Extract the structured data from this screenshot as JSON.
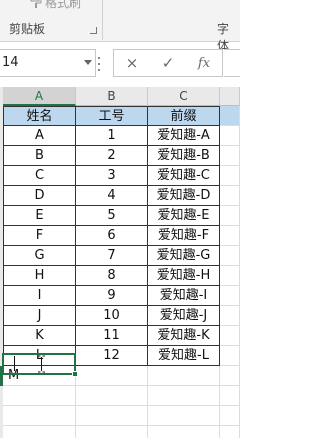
{
  "ribbon": {
    "format_painter_label": "格式刷",
    "clipboard_group_label": "剪贴板",
    "font_group_label": "字体"
  },
  "formula_bar": {
    "name_box_value": "14",
    "cancel_symbol": "×",
    "enter_symbol": "✓",
    "fx_label": "fx"
  },
  "columns": [
    "A",
    "B",
    "C"
  ],
  "table": {
    "headers": [
      "姓名",
      "工号",
      "前缀"
    ],
    "header_fill": "#bdd7ee",
    "rows": [
      [
        "A",
        "1",
        "爱知趣-A"
      ],
      [
        "B",
        "2",
        "爱知趣-B"
      ],
      [
        "C",
        "3",
        "爱知趣-C"
      ],
      [
        "D",
        "4",
        "爱知趣-D"
      ],
      [
        "E",
        "5",
        "爱知趣-E"
      ],
      [
        "F",
        "6",
        "爱知趣-F"
      ],
      [
        "G",
        "7",
        "爱知趣-G"
      ],
      [
        "H",
        "8",
        "爱知趣-H"
      ],
      [
        "I",
        "9",
        "爱知趣-I"
      ],
      [
        "J",
        "10",
        "爱知趣-J"
      ],
      [
        "K",
        "11",
        "爱知趣-K"
      ],
      [
        "L",
        "12",
        "爱知趣-L"
      ]
    ]
  },
  "active_cell": {
    "value": "M",
    "accent": "#217346"
  }
}
